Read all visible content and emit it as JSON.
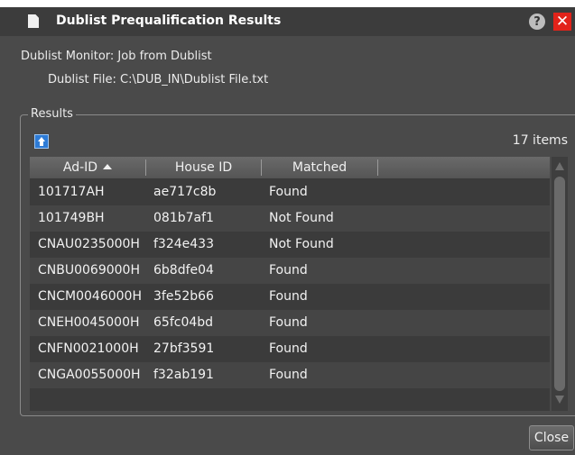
{
  "window": {
    "title": "Dublist Prequalification Results",
    "help_label": "?",
    "close_label": "✕"
  },
  "info": {
    "monitor_line": "Dublist Monitor: Job from Dublist",
    "file_line": "Dublist File: C:\\DUB_IN\\Dublist File.txt"
  },
  "results": {
    "legend": "Results",
    "count": "17 items",
    "columns": [
      "Ad-ID",
      "House ID",
      "Matched"
    ],
    "sort": {
      "column": "Ad-ID",
      "direction": "ascending"
    },
    "rows": [
      {
        "ad_id": "101717AH",
        "house_id": "ae717c8b",
        "matched": "Found"
      },
      {
        "ad_id": "101749BH",
        "house_id": "081b7af1",
        "matched": "Not Found"
      },
      {
        "ad_id": "CNAU0235000H",
        "house_id": "f324e433",
        "matched": "Not Found"
      },
      {
        "ad_id": "CNBU0069000H",
        "house_id": "6b8dfe04",
        "matched": "Found"
      },
      {
        "ad_id": "CNCM0046000H",
        "house_id": "3fe52b66",
        "matched": "Found"
      },
      {
        "ad_id": "CNEH0045000H",
        "house_id": "65fc04bd",
        "matched": "Found"
      },
      {
        "ad_id": "CNFN0021000H",
        "house_id": "27bf3591",
        "matched": "Found"
      },
      {
        "ad_id": "CNGA0055000H",
        "house_id": "f32ab191",
        "matched": "Found"
      }
    ]
  },
  "footer": {
    "close_label": "Close"
  },
  "colors": {
    "window_bg": "#4a4a4a",
    "titlebar_bg": "#3c3c3c",
    "close_red": "#e2231a",
    "row_odd": "#3b3b3b",
    "row_even": "#454545",
    "upload_icon_blue": "#2d7bd6"
  },
  "icons": {
    "title": "document-icon",
    "help": "help-icon",
    "close": "close-icon",
    "upload": "upload-icon",
    "sort": "sort-ascending-icon"
  }
}
